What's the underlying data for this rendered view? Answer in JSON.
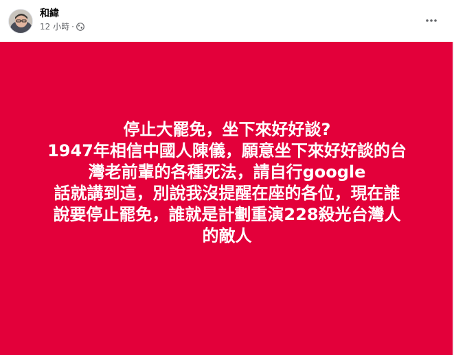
{
  "post": {
    "author": "和緯",
    "timestamp": "12 小時",
    "separator": "·",
    "privacy_icon": "globe-icon",
    "more_icon": "more-horizontal-icon",
    "avatar_icon": "profile-photo"
  },
  "content": {
    "background_color": "#e3003a",
    "text_color": "#ffffff",
    "lines": [
      "停止大罷免，坐下來好好談?",
      "1947年相信中國人陳儀，願意坐下來好好談的台",
      "灣老前輩的各種死法，請自行google",
      "話就講到這，別說我沒提醒在座的各位，現在誰",
      "說要停止罷免，誰就是計劃重演228殺光台灣人",
      "的敵人"
    ]
  }
}
